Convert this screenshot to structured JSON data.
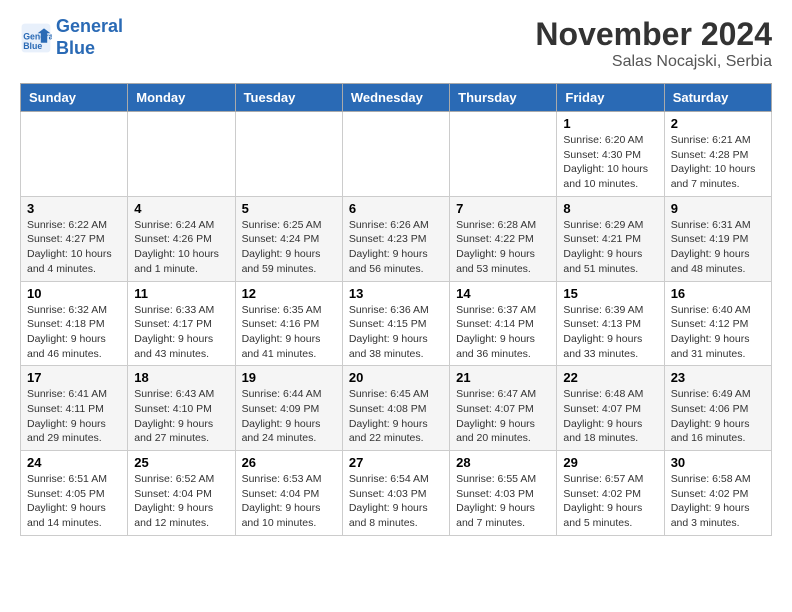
{
  "header": {
    "logo_line1": "General",
    "logo_line2": "Blue",
    "month_title": "November 2024",
    "location": "Salas Nocajski, Serbia"
  },
  "weekdays": [
    "Sunday",
    "Monday",
    "Tuesday",
    "Wednesday",
    "Thursday",
    "Friday",
    "Saturday"
  ],
  "weeks": [
    [
      {
        "day": "",
        "info": ""
      },
      {
        "day": "",
        "info": ""
      },
      {
        "day": "",
        "info": ""
      },
      {
        "day": "",
        "info": ""
      },
      {
        "day": "",
        "info": ""
      },
      {
        "day": "1",
        "info": "Sunrise: 6:20 AM\nSunset: 4:30 PM\nDaylight: 10 hours and 10 minutes."
      },
      {
        "day": "2",
        "info": "Sunrise: 6:21 AM\nSunset: 4:28 PM\nDaylight: 10 hours and 7 minutes."
      }
    ],
    [
      {
        "day": "3",
        "info": "Sunrise: 6:22 AM\nSunset: 4:27 PM\nDaylight: 10 hours and 4 minutes."
      },
      {
        "day": "4",
        "info": "Sunrise: 6:24 AM\nSunset: 4:26 PM\nDaylight: 10 hours and 1 minute."
      },
      {
        "day": "5",
        "info": "Sunrise: 6:25 AM\nSunset: 4:24 PM\nDaylight: 9 hours and 59 minutes."
      },
      {
        "day": "6",
        "info": "Sunrise: 6:26 AM\nSunset: 4:23 PM\nDaylight: 9 hours and 56 minutes."
      },
      {
        "day": "7",
        "info": "Sunrise: 6:28 AM\nSunset: 4:22 PM\nDaylight: 9 hours and 53 minutes."
      },
      {
        "day": "8",
        "info": "Sunrise: 6:29 AM\nSunset: 4:21 PM\nDaylight: 9 hours and 51 minutes."
      },
      {
        "day": "9",
        "info": "Sunrise: 6:31 AM\nSunset: 4:19 PM\nDaylight: 9 hours and 48 minutes."
      }
    ],
    [
      {
        "day": "10",
        "info": "Sunrise: 6:32 AM\nSunset: 4:18 PM\nDaylight: 9 hours and 46 minutes."
      },
      {
        "day": "11",
        "info": "Sunrise: 6:33 AM\nSunset: 4:17 PM\nDaylight: 9 hours and 43 minutes."
      },
      {
        "day": "12",
        "info": "Sunrise: 6:35 AM\nSunset: 4:16 PM\nDaylight: 9 hours and 41 minutes."
      },
      {
        "day": "13",
        "info": "Sunrise: 6:36 AM\nSunset: 4:15 PM\nDaylight: 9 hours and 38 minutes."
      },
      {
        "day": "14",
        "info": "Sunrise: 6:37 AM\nSunset: 4:14 PM\nDaylight: 9 hours and 36 minutes."
      },
      {
        "day": "15",
        "info": "Sunrise: 6:39 AM\nSunset: 4:13 PM\nDaylight: 9 hours and 33 minutes."
      },
      {
        "day": "16",
        "info": "Sunrise: 6:40 AM\nSunset: 4:12 PM\nDaylight: 9 hours and 31 minutes."
      }
    ],
    [
      {
        "day": "17",
        "info": "Sunrise: 6:41 AM\nSunset: 4:11 PM\nDaylight: 9 hours and 29 minutes."
      },
      {
        "day": "18",
        "info": "Sunrise: 6:43 AM\nSunset: 4:10 PM\nDaylight: 9 hours and 27 minutes."
      },
      {
        "day": "19",
        "info": "Sunrise: 6:44 AM\nSunset: 4:09 PM\nDaylight: 9 hours and 24 minutes."
      },
      {
        "day": "20",
        "info": "Sunrise: 6:45 AM\nSunset: 4:08 PM\nDaylight: 9 hours and 22 minutes."
      },
      {
        "day": "21",
        "info": "Sunrise: 6:47 AM\nSunset: 4:07 PM\nDaylight: 9 hours and 20 minutes."
      },
      {
        "day": "22",
        "info": "Sunrise: 6:48 AM\nSunset: 4:07 PM\nDaylight: 9 hours and 18 minutes."
      },
      {
        "day": "23",
        "info": "Sunrise: 6:49 AM\nSunset: 4:06 PM\nDaylight: 9 hours and 16 minutes."
      }
    ],
    [
      {
        "day": "24",
        "info": "Sunrise: 6:51 AM\nSunset: 4:05 PM\nDaylight: 9 hours and 14 minutes."
      },
      {
        "day": "25",
        "info": "Sunrise: 6:52 AM\nSunset: 4:04 PM\nDaylight: 9 hours and 12 minutes."
      },
      {
        "day": "26",
        "info": "Sunrise: 6:53 AM\nSunset: 4:04 PM\nDaylight: 9 hours and 10 minutes."
      },
      {
        "day": "27",
        "info": "Sunrise: 6:54 AM\nSunset: 4:03 PM\nDaylight: 9 hours and 8 minutes."
      },
      {
        "day": "28",
        "info": "Sunrise: 6:55 AM\nSunset: 4:03 PM\nDaylight: 9 hours and 7 minutes."
      },
      {
        "day": "29",
        "info": "Sunrise: 6:57 AM\nSunset: 4:02 PM\nDaylight: 9 hours and 5 minutes."
      },
      {
        "day": "30",
        "info": "Sunrise: 6:58 AM\nSunset: 4:02 PM\nDaylight: 9 hours and 3 minutes."
      }
    ]
  ]
}
